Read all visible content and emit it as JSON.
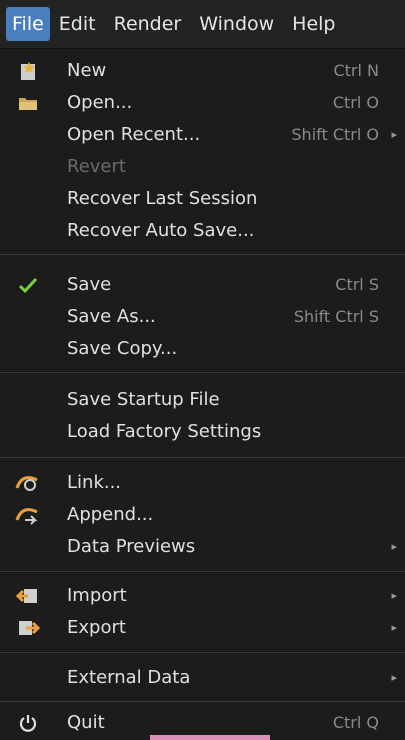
{
  "menubar": {
    "items": [
      "File",
      "Edit",
      "Render",
      "Window",
      "Help"
    ]
  },
  "menu": {
    "items": [
      {
        "label": "New",
        "shortcut": "Ctrl N",
        "icon": "new-file-icon"
      },
      {
        "label": "Open...",
        "shortcut": "Ctrl O",
        "icon": "folder-icon"
      },
      {
        "label": "Open Recent...",
        "shortcut": "Shift Ctrl O",
        "submenu": true
      },
      {
        "label": "Revert",
        "disabled": true
      },
      {
        "label": "Recover Last Session"
      },
      {
        "label": "Recover Auto Save..."
      },
      {
        "label": "Save",
        "shortcut": "Ctrl S",
        "icon": "checkmark-icon"
      },
      {
        "label": "Save As...",
        "shortcut": "Shift Ctrl S"
      },
      {
        "label": "Save Copy..."
      },
      {
        "label": "Save Startup File"
      },
      {
        "label": "Load Factory Settings"
      },
      {
        "label": "Link...",
        "icon": "link-icon"
      },
      {
        "label": "Append...",
        "icon": "append-icon"
      },
      {
        "label": "Data Previews",
        "submenu": true
      },
      {
        "label": "Import",
        "icon": "import-icon",
        "submenu": true
      },
      {
        "label": "Export",
        "icon": "export-icon",
        "submenu": true
      },
      {
        "label": "External Data",
        "submenu": true
      },
      {
        "label": "Quit",
        "shortcut": "Ctrl Q",
        "icon": "power-icon"
      }
    ],
    "arrow_glyph": "▸"
  },
  "colors": {
    "accent": "#4a7fbf",
    "check": "#7ccf3c"
  }
}
